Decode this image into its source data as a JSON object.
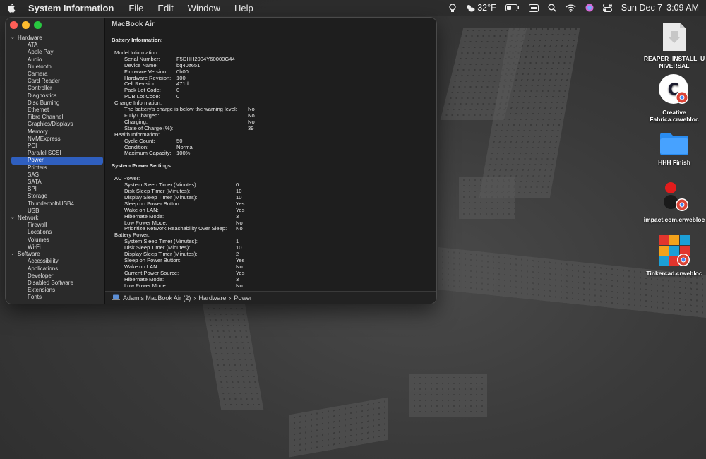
{
  "menubar": {
    "app_name": "System Information",
    "menus": [
      "File",
      "Edit",
      "Window",
      "Help"
    ],
    "weather": "32°F",
    "date": "Sun Dec 7",
    "time": "3:09 AM"
  },
  "window": {
    "title": "MacBook Air",
    "sidebar": {
      "hardware_label": "Hardware",
      "hardware": [
        "ATA",
        "Apple Pay",
        "Audio",
        "Bluetooth",
        "Camera",
        "Card Reader",
        "Controller",
        "Diagnostics",
        "Disc Burning",
        "Ethernet",
        "Fibre Channel",
        "Graphics/Displays",
        "Memory",
        "NVMExpress",
        "PCI",
        "Parallel SCSI",
        "Power",
        "Printers",
        "SAS",
        "SATA",
        "SPI",
        "Storage",
        "Thunderbolt/USB4",
        "USB"
      ],
      "network_label": "Network",
      "network": [
        "Firewall",
        "Locations",
        "Volumes",
        "Wi-Fi"
      ],
      "software_label": "Software",
      "software": [
        "Accessibility",
        "Applications",
        "Developer",
        "Disabled Software",
        "Extensions",
        "Fonts"
      ],
      "selected": "Power"
    },
    "report": {
      "battery_heading": "Battery Information:",
      "model_heading": "Model Information:",
      "model": [
        [
          "Serial Number:",
          "F5DHH2004Y60000G44"
        ],
        [
          "Device Name:",
          "bq40z651"
        ],
        [
          "Firmware Version:",
          "0b00"
        ],
        [
          "Hardware Revision:",
          "100"
        ],
        [
          "Cell Revision:",
          "471d"
        ],
        [
          "Pack Lot Code:",
          "0"
        ],
        [
          "PCB Lot Code:",
          "0"
        ]
      ],
      "charge_heading": "Charge Information:",
      "charge": [
        [
          "The battery's charge is below the warning level:",
          "No"
        ],
        [
          "Fully Charged:",
          "No"
        ],
        [
          "Charging:",
          "No"
        ],
        [
          "State of Charge (%):",
          "39"
        ]
      ],
      "health_heading": "Health Information:",
      "health": [
        [
          "Cycle Count:",
          "50"
        ],
        [
          "Condition:",
          "Normal"
        ],
        [
          "Maximum Capacity:",
          "100%"
        ]
      ],
      "power_heading": "System Power Settings:",
      "ac_heading": "AC Power:",
      "ac": [
        [
          "System Sleep Timer (Minutes):",
          "0"
        ],
        [
          "Disk Sleep Timer (Minutes):",
          "10"
        ],
        [
          "Display Sleep Timer (Minutes):",
          "10"
        ],
        [
          "Sleep on Power Button:",
          "Yes"
        ],
        [
          "Wake on LAN:",
          "Yes"
        ],
        [
          "Hibernate Mode:",
          "3"
        ],
        [
          "Low Power Mode:",
          "No"
        ],
        [
          "Prioritize Network Reachability Over Sleep:",
          "No"
        ]
      ],
      "battery_power_heading": "Battery Power:",
      "battery_power": [
        [
          "System Sleep Timer (Minutes):",
          "1"
        ],
        [
          "Disk Sleep Timer (Minutes):",
          "10"
        ],
        [
          "Display Sleep Timer (Minutes):",
          "2"
        ],
        [
          "Sleep on Power Button:",
          "Yes"
        ],
        [
          "Wake on LAN:",
          "No"
        ],
        [
          "Current Power Source:",
          "Yes"
        ],
        [
          "Hibernate Mode:",
          "3"
        ],
        [
          "Low Power Mode:",
          "No"
        ]
      ]
    },
    "pathbar": {
      "computer": "Adam’s MacBook Air (2)",
      "section": "Hardware",
      "item": "Power"
    }
  },
  "desktop": {
    "icons": [
      {
        "label": "REAPER_INSTALL_UNIVERSAL"
      },
      {
        "label": "Creative Fabrica.crwebloc"
      },
      {
        "label": "HHH Finish"
      },
      {
        "label": "impact.com.crwebloc"
      },
      {
        "label": "Tinkercad.crwebloc"
      }
    ]
  },
  "colors": {
    "selection": "#2f5fbf",
    "close": "#ff5f57",
    "minimize": "#febc2e",
    "zoom": "#28c840",
    "folder": "#2a8cf0"
  }
}
